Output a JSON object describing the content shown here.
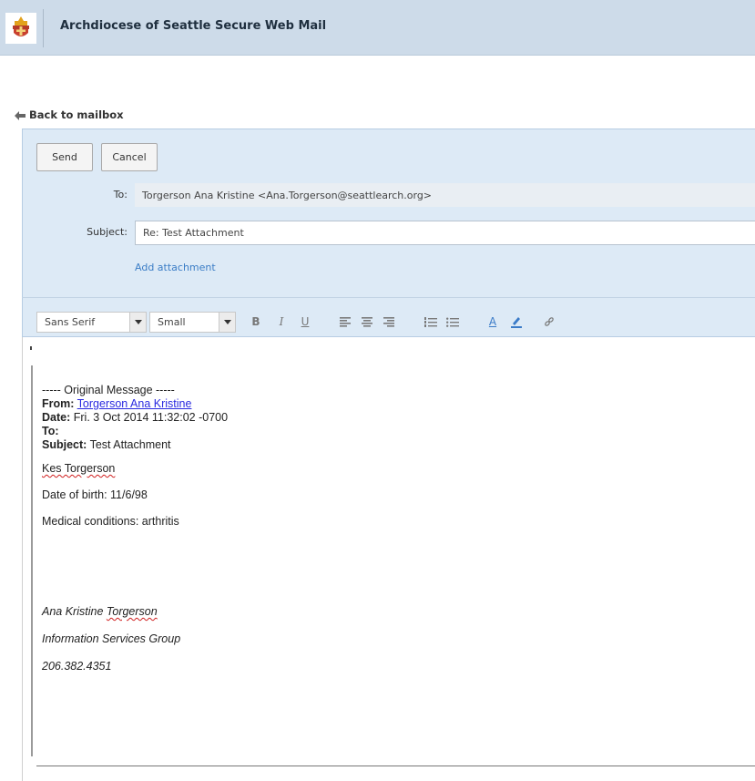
{
  "header": {
    "title": "Archdiocese of Seattle Secure Web Mail"
  },
  "nav": {
    "back_label": "Back to mailbox"
  },
  "actions": {
    "send_label": "Send",
    "cancel_label": "Cancel"
  },
  "compose": {
    "to_label": "To:",
    "to_value": "Torgerson Ana Kristine <Ana.Torgerson@seattlearch.org>",
    "subject_label": "Subject:",
    "subject_value": "Re: Test Attachment",
    "add_attachment_label": "Add attachment"
  },
  "toolbar": {
    "font_family": "Sans Serif",
    "font_size": "Small",
    "icons": [
      "bold-icon",
      "italic-icon",
      "underline-icon",
      "align-left-icon",
      "align-center-icon",
      "align-right-icon",
      "numbered-list-icon",
      "bulleted-list-icon",
      "text-color-icon",
      "highlight-icon",
      "link-icon"
    ]
  },
  "message": {
    "original_header": "----- Original Message -----",
    "from_label": "From:",
    "from_value": "Torgerson Ana Kristine",
    "date_label": "Date:",
    "date_value": "Fri. 3 Oct 2014 11:32:02 -0700",
    "to_label": "To:",
    "subject_label": "Subject:",
    "subject_value": "Test Attachment",
    "name_line": "Kes Torgerson",
    "dob_line": "Date of birth:  11/6/98",
    "medical_line": "Medical conditions:  arthritis",
    "sig_first": "Ana Kristine ",
    "sig_last": "Torgerson",
    "sig_group": "Information Services Group",
    "sig_phone": "206.382.4351"
  },
  "colors": {
    "header_bg": "#cddbe9",
    "panel_bg": "#ddeaf6",
    "link": "#3b7dc6",
    "accent_link": "#2a2ae0"
  }
}
